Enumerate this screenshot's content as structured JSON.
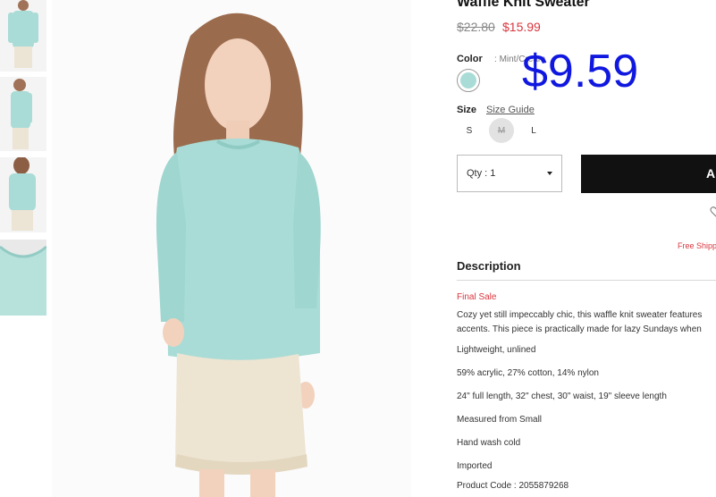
{
  "product": {
    "title": "Waffle Knit Sweater",
    "price_original": "$22.80",
    "price_sale": "$15.99",
    "promo_price": "$9.59"
  },
  "color": {
    "label": "Color",
    "separator": ":",
    "value": "Mint/Cream",
    "swatch_color": "#a9dcd6"
  },
  "size": {
    "label": "Size",
    "guide_link": "Size Guide",
    "options": [
      "S",
      "M",
      "L"
    ],
    "unavailable": "M"
  },
  "qty": {
    "label": "Qty : 1"
  },
  "cart": {
    "button_label": "ADD TO BAG"
  },
  "shipping": {
    "text": "Free Shipping"
  },
  "description": {
    "heading": "Description",
    "final_sale": "Final Sale",
    "paragraph_line1": "Cozy yet still impeccably chic, this waffle knit sweater features",
    "paragraph_line2": "accents. This piece is practically made for lazy Sundays when",
    "details": [
      "Lightweight, unlined",
      "59% acrylic, 27% cotton, 14% nylon",
      "24\" full length, 32\" chest, 30\" waist, 19\" sleeve length",
      "Measured from Small",
      "Hand wash cold",
      "Imported",
      "Product Code : 2055879268"
    ]
  },
  "colors": {
    "sale_red": "#d9363e",
    "promo_blue": "#1018e0",
    "button_black": "#111111"
  }
}
